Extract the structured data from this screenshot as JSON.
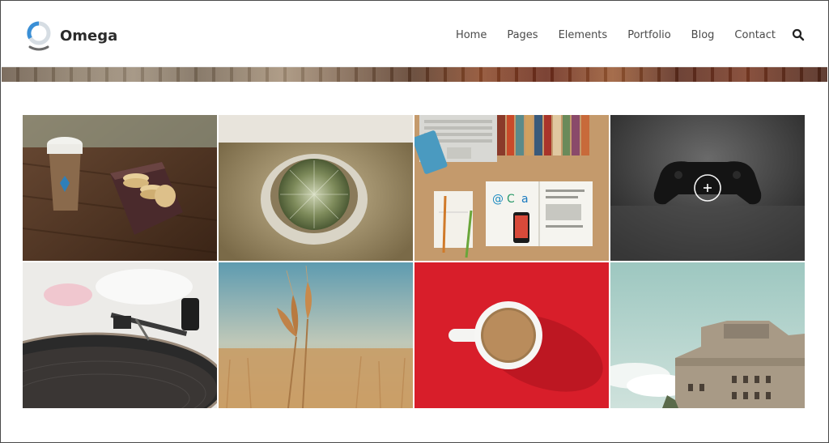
{
  "brand": {
    "name": "Omega"
  },
  "nav": {
    "items": [
      "Home",
      "Pages",
      "Elements",
      "Portfolio",
      "Blog",
      "Contact"
    ],
    "search_icon": "search-icon"
  },
  "portfolio": {
    "items": [
      {
        "subject": "coffee-cup-and-macarons"
      },
      {
        "subject": "cactus-in-pot"
      },
      {
        "subject": "laptop-desk-flatlay"
      },
      {
        "subject": "game-controller",
        "overlay_icon": "plus-icon"
      },
      {
        "subject": "record-player"
      },
      {
        "subject": "wheat-stalks"
      },
      {
        "subject": "coffee-on-red"
      },
      {
        "subject": "concrete-bunker"
      }
    ]
  },
  "colors": {
    "accent": "#3a8fd6",
    "text": "#4a4a4a",
    "brand_text": "#2b2b2b"
  }
}
